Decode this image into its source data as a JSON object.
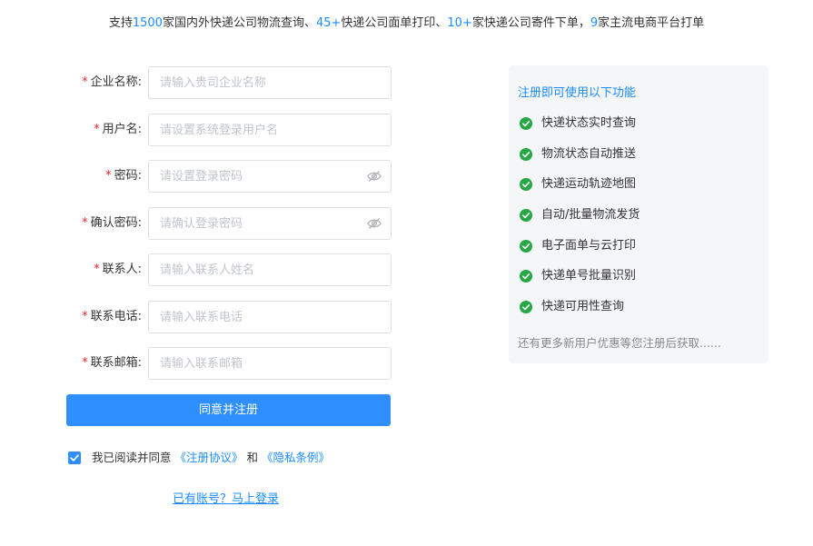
{
  "tagline": {
    "p1": "支持",
    "n1": "1500",
    "p2": "家国内外快递公司物流查询、",
    "n2": "45+",
    "p3": "快递公司面单打印、",
    "n3": "10+",
    "p4": "家快递公司寄件下单，",
    "n4": "9",
    "p5": "家主流电商平台打单"
  },
  "form": {
    "company": {
      "label": "企业名称:",
      "placeholder": "请输入贵司企业名称"
    },
    "username": {
      "label": "用户名:",
      "placeholder": "请设置系统登录用户名"
    },
    "password": {
      "label": "密码:",
      "placeholder": "请设置登录密码"
    },
    "confirm": {
      "label": "确认密码:",
      "placeholder": "请确认登录密码"
    },
    "contact": {
      "label": "联系人:",
      "placeholder": "请输入联系人姓名"
    },
    "phone": {
      "label": "联系电话:",
      "placeholder": "请输入联系电话"
    },
    "email": {
      "label": "联系邮箱:",
      "placeholder": "请输入联系邮箱"
    },
    "required_mark": "*",
    "submit_label": "同意并注册"
  },
  "agreement": {
    "checked": true,
    "prefix": "我已阅读并同意",
    "terms": "《注册协议》",
    "and": "和",
    "privacy": "《隐私条例》"
  },
  "login_link": "已有账号？马上登录",
  "panel": {
    "title": "注册即可使用以下功能",
    "features": [
      "快递状态实时查询",
      "物流状态自动推送",
      "快递运动轨迹地图",
      "自动/批量物流发货",
      "电子面单与云打印",
      "快递单号批量识别",
      "快递可用性查询"
    ],
    "footer": "还有更多新用户优惠等您注册后获取......"
  },
  "colors": {
    "accent": "#2f8fff",
    "link": "#1a8cff",
    "required": "#f5222d",
    "check": "#28a745"
  }
}
